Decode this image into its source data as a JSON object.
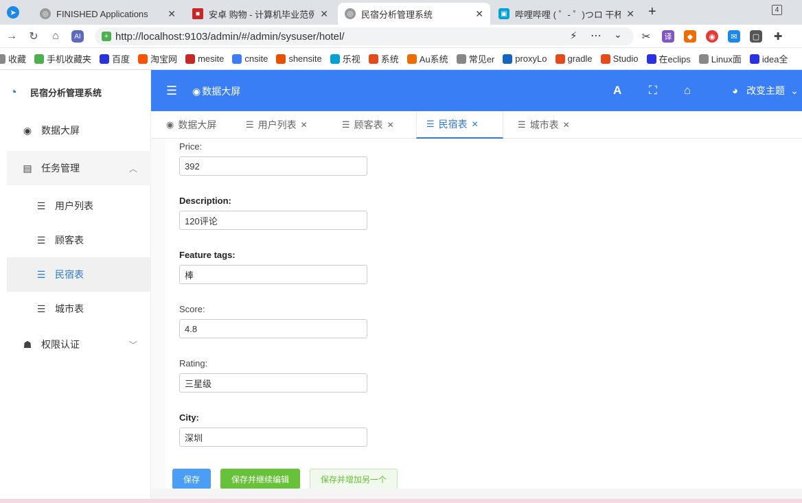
{
  "browser": {
    "tabs": [
      {
        "title": "FINISHED Applications",
        "color": "#777777"
      },
      {
        "title": "安卓 购物 - 计算机毕业范例设",
        "color": "#c62828"
      },
      {
        "title": "民宿分析管理系统",
        "color": "#777777"
      },
      {
        "title": "哔哩哔哩 ( ゜- ゜)つロ 干杯~-b",
        "color": "#00a1d6"
      }
    ],
    "tab_count": "4",
    "url": "http://localhost:9103/admin/#/admin/sysuser/hotel/",
    "bookmarks": [
      {
        "label": "收藏",
        "color": "#888888"
      },
      {
        "label": "手机收藏夹",
        "color": "#4caf50"
      },
      {
        "label": "百度",
        "color": "#2932e1"
      },
      {
        "label": "淘宝网",
        "color": "#ff5000"
      },
      {
        "label": "mesite",
        "color": "#c62828"
      },
      {
        "label": "cnsite",
        "color": "#3a7ef5"
      },
      {
        "label": "shensite",
        "color": "#e65100"
      },
      {
        "label": "乐视",
        "color": "#00a1d6"
      },
      {
        "label": "系统",
        "color": "#e64a19"
      },
      {
        "label": "Au系统",
        "color": "#ef6c00"
      },
      {
        "label": "常见er",
        "color": "#888888"
      },
      {
        "label": "proxyLo",
        "color": "#1565c0"
      },
      {
        "label": "gradle",
        "color": "#e64a19"
      },
      {
        "label": "Studio",
        "color": "#e64a19"
      },
      {
        "label": "在eclips",
        "color": "#2932e1"
      },
      {
        "label": "Linux面",
        "color": "#888888"
      },
      {
        "label": "idea全",
        "color": "#2932e1"
      }
    ]
  },
  "app": {
    "name": "民宿分析管理系统",
    "header_title": "数据大屏",
    "theme_label": "改变主题",
    "accent": "#3a7ef5",
    "menu": [
      {
        "label": "数据大屏",
        "icon": "eye-icon"
      },
      {
        "label": "任务管理",
        "icon": "table-icon"
      },
      {
        "label": "用户列表",
        "icon": "list-icon"
      },
      {
        "label": "顾客表",
        "icon": "list-icon"
      },
      {
        "label": "民宿表",
        "icon": "list-icon"
      },
      {
        "label": "城市表",
        "icon": "list-icon"
      },
      {
        "label": "权限认证",
        "icon": "user-lock-icon"
      }
    ],
    "tags": [
      {
        "label": "数据大屏"
      },
      {
        "label": "用户列表"
      },
      {
        "label": "顾客表"
      },
      {
        "label": "民宿表"
      },
      {
        "label": "城市表"
      }
    ]
  },
  "form": {
    "price": {
      "label": "Price:",
      "value": "392"
    },
    "description": {
      "label": "Description:",
      "value": "120评论"
    },
    "feature_tags": {
      "label": "Feature tags:",
      "value": "棒"
    },
    "score": {
      "label": "Score:",
      "value": "4.8"
    },
    "rating": {
      "label": "Rating:",
      "value": "三星级"
    },
    "city": {
      "label": "City:",
      "value": "深圳"
    },
    "buttons": {
      "save": "保存",
      "save_continue": "保存并继续编辑",
      "save_add": "保存并增加另一个"
    }
  }
}
